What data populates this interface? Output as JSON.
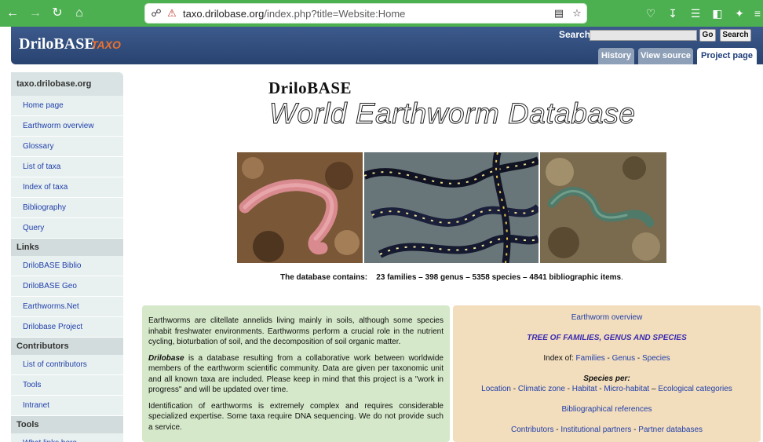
{
  "browser": {
    "url_host": "taxo.drilobase.org",
    "url_path": "/index.php?title=Website:Home",
    "icons": [
      "back-arrow-icon",
      "forward-arrow-icon",
      "reload-icon",
      "home-icon",
      "shield-icon",
      "lock-icon",
      "reader-icon",
      "star-icon",
      "pocket-icon",
      "download-icon",
      "library-icon",
      "sidebar-icon",
      "extensions-icon",
      "menu-icon"
    ]
  },
  "header": {
    "logo_main": "DriloBASE",
    "logo_sub": "TAXO",
    "search_label": "Search",
    "go_button": "Go",
    "search_button": "Search",
    "tabs": [
      {
        "label": "History",
        "active": false
      },
      {
        "label": "View source",
        "active": false
      },
      {
        "label": "Project page",
        "active": true
      }
    ]
  },
  "sidebar": {
    "sections": [
      {
        "title": "taxo.drilobase.org",
        "items": [
          "Home page",
          "Earthworm overview",
          "Glossary",
          "List of taxa",
          "Index of taxa",
          "Bibliography",
          "Query"
        ]
      },
      {
        "title": "Links",
        "items": [
          "DriloBASE Biblio",
          "DriloBASE Geo",
          "Earthworms.Net",
          "Drilobase Project"
        ]
      },
      {
        "title": "Contributors",
        "items": [
          "List of contributors",
          "Tools",
          "Intranet"
        ]
      },
      {
        "title": "Tools",
        "items": [
          "What links here"
        ]
      }
    ]
  },
  "main": {
    "title_small": "DriloBASE",
    "title_big": "World Earthworm Database",
    "photos": [
      "pink-earthworm-photo",
      "striped-earthworms-photo",
      "green-earthworm-photo"
    ],
    "stats_label": "The database contains:",
    "stats_value": "23 families – 398 genus – 5358 species – 4841 bibliographic items",
    "stats_period": ".",
    "intro": {
      "p1": "Earthworms are clitellate annelids living mainly in soils, although some species inhabit freshwater environments. Earthworms perform a crucial role in the nutrient cycling, bioturbation of soil, and the decomposition of soil organic matter.",
      "p2_brand": "Drilobase",
      "p2_rest": " is a database resulting from a collaborative work between worldwide members of the earthworm scientific community. Data are given per taxonomic unit and all known taxa are included. Please keep in mind that this project is a \"work in progress\" and will be updated over time.",
      "p3": "Identification of earthworms is extremely complex and requires considerable specialized expertise. Some taxa require DNA sequencing. We do not provide such a service."
    },
    "links_box": {
      "overview": "Earthworm overview",
      "tree": "TREE OF FAMILIES, GENUS AND SPECIES",
      "index_label": "Index of:",
      "index_links": [
        "Families",
        "Genus",
        "Species"
      ],
      "species_per_label": "Species per:",
      "species_per_links": [
        "Location",
        "Climatic zone",
        "Habitat",
        "Micro-habitat",
        "Ecological categories"
      ],
      "biblio": "Bibliographical references",
      "people_links": [
        "Contributors",
        "Institutional partners",
        "Partner databases"
      ]
    }
  }
}
